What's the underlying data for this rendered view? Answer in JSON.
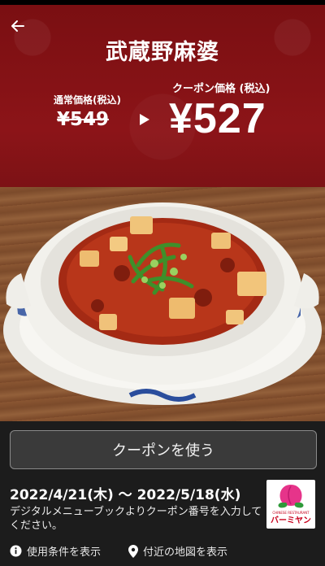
{
  "header": {
    "title": "武蔵野麻婆"
  },
  "pricing": {
    "regular_label": "通常価格(税込)",
    "regular_price": "¥549",
    "coupon_label": "クーポン価格 (税込)",
    "coupon_price": "¥527"
  },
  "action": {
    "use_coupon_label": "クーポンを使う"
  },
  "details": {
    "validity_period": "2022/4/21(木) ～ 2022/5/18(水)",
    "description": "デジタルメニューブックよりクーポン番号を入力してください。"
  },
  "brand": {
    "logo_text": "バーミヤン",
    "logo_subtext": "CHINESE RESTAURANT"
  },
  "footer": {
    "terms_label": "使用条件を表示",
    "map_label": "付近の地図を表示"
  },
  "colors": {
    "header_red": "#8c1418",
    "button_bg": "#3a3a3a",
    "background": "#1c1c1c",
    "logo_red": "#c8001c"
  }
}
